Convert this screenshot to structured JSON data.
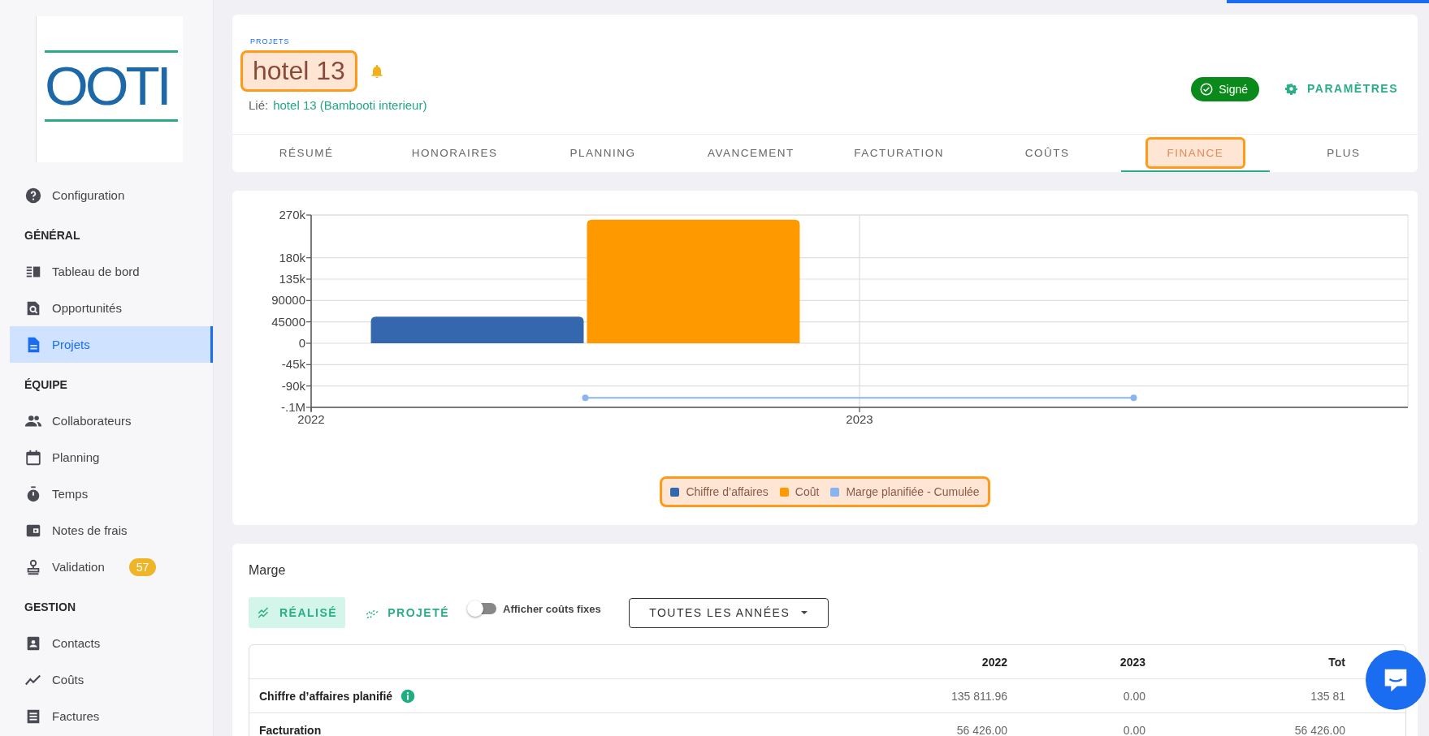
{
  "sidebar": {
    "logo": "OOTI",
    "entries": [
      {
        "kind": "item",
        "label": "Configuration",
        "selected": false
      },
      {
        "kind": "heading",
        "label": "GÉNÉRAL"
      },
      {
        "kind": "item",
        "label": "Tableau de bord",
        "selected": false
      },
      {
        "kind": "item",
        "label": "Opportunités",
        "selected": false
      },
      {
        "kind": "item",
        "label": "Projets",
        "selected": true
      },
      {
        "kind": "heading",
        "label": "ÉQUIPE"
      },
      {
        "kind": "item",
        "label": "Collaborateurs",
        "selected": false
      },
      {
        "kind": "item",
        "label": "Planning",
        "selected": false
      },
      {
        "kind": "item",
        "label": "Temps",
        "selected": false
      },
      {
        "kind": "item",
        "label": "Notes de frais",
        "selected": false
      },
      {
        "kind": "item",
        "label": "Validation",
        "selected": false,
        "badge": "57"
      },
      {
        "kind": "heading",
        "label": "GESTION"
      },
      {
        "kind": "item",
        "label": "Contacts",
        "selected": false
      },
      {
        "kind": "item",
        "label": "Coûts",
        "selected": false
      },
      {
        "kind": "item",
        "label": "Factures",
        "selected": false
      }
    ]
  },
  "project": {
    "breadcrumb": "PROJETS",
    "title": "hotel 13",
    "title_highlighted": true,
    "linked_label": "Lié:",
    "linked_value": "hotel 13 (Bambooti interieur)",
    "status": "Signé",
    "settings": "PARAMÈTRES"
  },
  "tabs": [
    {
      "label": "RÉSUMÉ",
      "selected": false,
      "highlighted": false
    },
    {
      "label": "HONORAIRES",
      "selected": false,
      "highlighted": false
    },
    {
      "label": "PLANNING",
      "selected": false,
      "highlighted": false
    },
    {
      "label": "AVANCEMENT",
      "selected": false,
      "highlighted": false
    },
    {
      "label": "FACTURATION",
      "selected": false,
      "highlighted": false
    },
    {
      "label": "COÛTS",
      "selected": false,
      "highlighted": false
    },
    {
      "label": "FINANCE",
      "selected": true,
      "highlighted": true
    },
    {
      "label": "PLUS",
      "selected": false,
      "highlighted": false
    }
  ],
  "chart": {
    "legend_highlighted": true,
    "chart_data": {
      "type": "bar",
      "x": [
        2022.5,
        2023.5
      ],
      "xlim": [
        2022,
        2024
      ],
      "xticks": [
        2022,
        2023
      ],
      "ylim": [
        -135000,
        270000
      ],
      "yticks": [
        {
          "value": 270000,
          "label": "270k"
        },
        {
          "value": 180000,
          "label": "180k"
        },
        {
          "value": 135000,
          "label": "135k"
        },
        90000,
        45000,
        0,
        {
          "value": -45000,
          "label": "-45k"
        },
        {
          "value": -90000,
          "label": "-90k"
        },
        {
          "value": -135000,
          "label": "-.1M"
        }
      ],
      "series": [
        {
          "name": "Chiffre d’affaires",
          "color": "#3467ad",
          "type": "bar",
          "values": [
            56000,
            null
          ]
        },
        {
          "name": "Coût",
          "color": "#ff9900",
          "type": "bar",
          "values": [
            260000,
            null
          ]
        },
        {
          "name": "Marge planifiée - Cumulée",
          "color": "#8ab4f0",
          "type": "line",
          "marker": "circle",
          "values": [
            -115000,
            -115000
          ]
        }
      ],
      "stacked": false,
      "grid": true
    }
  },
  "margin": {
    "title": "Marge",
    "modes": [
      {
        "label": "RÉALISÉ",
        "selected": true
      },
      {
        "label": "PROJETÉ",
        "selected": false
      }
    ],
    "toggle": {
      "label": "Afficher coûts fixes",
      "on": false
    },
    "year_select": "TOUTES LES ANNÉES",
    "table": {
      "columns": [
        "2022",
        "2023",
        "Tot"
      ],
      "rows": [
        {
          "label": "Chiffre d’affaires planifié",
          "info": true,
          "cells": [
            "135 811.96",
            "0.00",
            "135 81"
          ]
        },
        {
          "label": "Facturation",
          "info": false,
          "cells": [
            "56 426.00",
            "0.00",
            "56 426.00"
          ]
        }
      ]
    }
  }
}
